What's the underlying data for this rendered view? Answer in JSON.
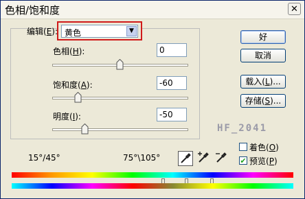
{
  "dialog": {
    "title": "色相/饱和度",
    "close_glyph": "✕"
  },
  "edit": {
    "label_pre": "编辑(",
    "label_key": "E",
    "label_post": "):",
    "value": "黄色",
    "highlight_color": "#d01a1a"
  },
  "hue": {
    "label_pre": "色相(",
    "label_key": "H",
    "label_post": "):",
    "value": "0"
  },
  "saturation": {
    "label_pre": "饱和度(",
    "label_key": "A",
    "label_post": "):",
    "value": "-60"
  },
  "lightness": {
    "label_pre": "明度(",
    "label_key": "I",
    "label_post": "):",
    "value": "-50"
  },
  "buttons": {
    "ok": "好",
    "cancel": "取消",
    "load_pre": "载入(",
    "load_key": "L",
    "load_post": ")...",
    "save_pre": "存储(",
    "save_key": "S",
    "save_post": ")..."
  },
  "range": {
    "left": "15°/45°",
    "right": "75°\\105°"
  },
  "options": {
    "colorize_pre": "着色(",
    "colorize_key": "O",
    "colorize_post": ")",
    "colorize_checked": false,
    "preview_pre": "预览(",
    "preview_key": "P",
    "preview_post": ")",
    "preview_checked": true
  },
  "watermark": "HF_2041",
  "icons": [
    "eyedropper-icon",
    "eyedropper-plus-icon",
    "eyedropper-minus-icon"
  ]
}
